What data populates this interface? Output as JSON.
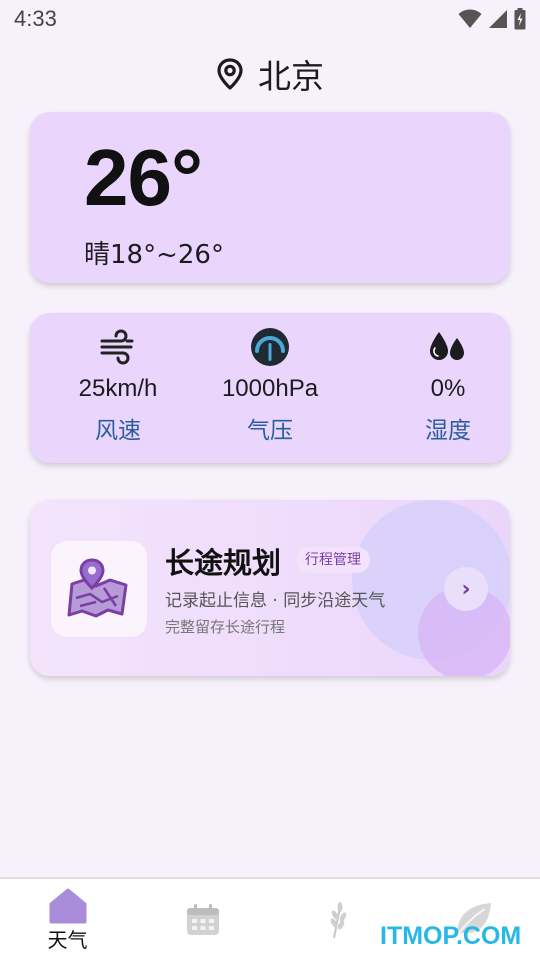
{
  "status": {
    "time": "4:33"
  },
  "location": {
    "name": "北京"
  },
  "weather": {
    "temperature": "26°",
    "range": "晴18°~26°"
  },
  "metrics": [
    {
      "value": "25km/h",
      "label": "风速",
      "icon": "wind-icon"
    },
    {
      "value": "1000hPa",
      "label": "气压",
      "icon": "gauge-icon"
    },
    {
      "value": "0%",
      "label": "湿度",
      "icon": "water-drops-icon"
    }
  ],
  "plan": {
    "title": "长途规划",
    "badge": "行程管理",
    "subtitle": "记录起止信息 · 同步沿途天气",
    "description": "完整留存长途行程",
    "arrow": "›"
  },
  "nav": [
    {
      "label": "天气",
      "icon": "home-icon",
      "active": true
    },
    {
      "label": "",
      "icon": "calendar-icon",
      "active": false
    },
    {
      "label": "",
      "icon": "wheat-icon",
      "active": false
    },
    {
      "label": "",
      "icon": "leaf-icon",
      "active": false
    }
  ],
  "watermark": "ITMOP.COM",
  "colors": {
    "background": "#f7f1fb",
    "card": "#ead6fc",
    "accent_purple": "#7a3fa3",
    "label_blue": "#2c5e9b",
    "watermark": "#27b8e6"
  }
}
